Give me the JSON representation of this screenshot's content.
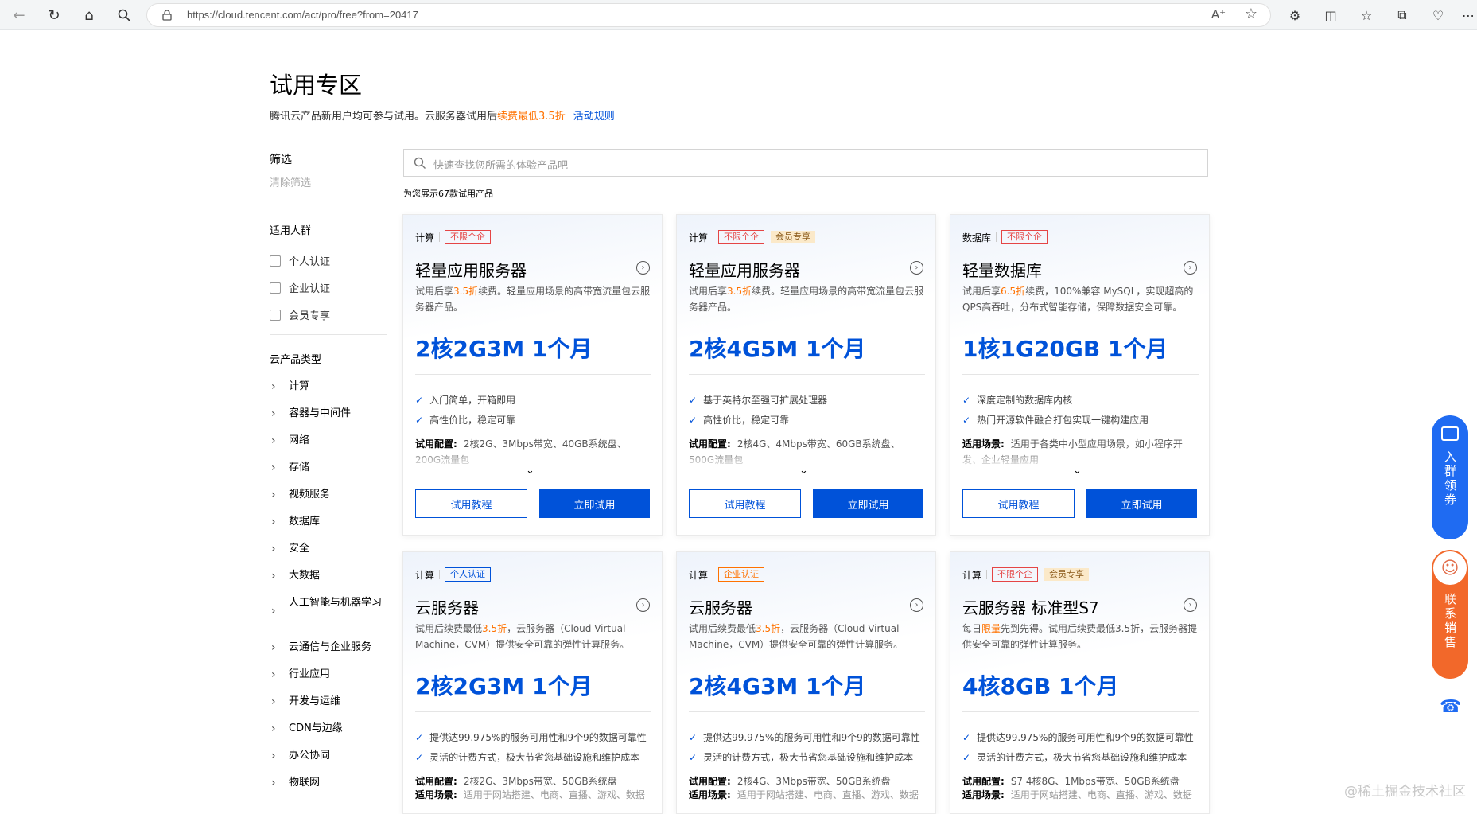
{
  "browser": {
    "url": "https://cloud.tencent.com/act/pro/free?from=20417"
  },
  "header": {
    "title": "试用专区",
    "subtitle_prefix": "腾讯云产品新用户均可参与试用。云服务器试用后",
    "subtitle_highlight": "续费最低3.5折",
    "rules_link": "活动规则"
  },
  "filter": {
    "title": "筛选",
    "clear": "清除筛选",
    "audience_title": "适用人群",
    "audience": [
      "个人认证",
      "企业认证",
      "会员专享"
    ],
    "type_title": "云产品类型",
    "categories": [
      "计算",
      "容器与中间件",
      "网络",
      "存储",
      "视频服务",
      "数据库",
      "安全",
      "大数据",
      "人工智能与机器学习",
      "云通信与企业服务",
      "行业应用",
      "开发与运维",
      "CDN与边缘",
      "办公协同",
      "物联网"
    ]
  },
  "search": {
    "placeholder": "快速查找您所需的体验产品吧",
    "result_count": "为您展示67款试用产品"
  },
  "cards": [
    {
      "category": "计算",
      "tag1": "不限个企",
      "tag2": "",
      "name": "轻量应用服务器",
      "desc_a": "试用后享",
      "desc_o": "3.5折",
      "desc_b": "续费。轻量应用场景的高带宽流量包云服务器产品。",
      "spec": "2核2G3M  1个月",
      "feat1": "入门简单，开箱即用",
      "feat2": "高性价比，稳定可靠",
      "cfg_label": "试用配置:",
      "cfg": "2核2G、3Mbps带宽、40GB系统盘、200G流量包",
      "tutorial": "试用教程",
      "try": "立即试用"
    },
    {
      "category": "计算",
      "tag1": "不限个企",
      "tag2": "会员专享",
      "name": "轻量应用服务器",
      "desc_a": "试用后享",
      "desc_o": "3.5折",
      "desc_b": "续费。轻量应用场景的高带宽流量包云服务器产品。",
      "spec": "2核4G5M  1个月",
      "feat1": "基于英特尔至强可扩展处理器",
      "feat2": "高性价比，稳定可靠",
      "cfg_label": "试用配置:",
      "cfg": "2核4G、4Mbps带宽、60GB系统盘、500G流量包",
      "tutorial": "试用教程",
      "try": "立即试用"
    },
    {
      "category": "数据库",
      "tag1": "不限个企",
      "tag2": "",
      "name": "轻量数据库",
      "desc_a": "试用后享",
      "desc_o": "6.5折",
      "desc_b": "续费，100%兼容 MySQL，实现超高的QPS高吞吐，分布式智能存储，保障数据安全可靠。",
      "spec": "1核1G20GB  1个月",
      "feat1": "深度定制的数据库内核",
      "feat2": "热门开源软件融合打包实现一键构建应用",
      "cfg_label": "适用场景:",
      "cfg": "适用于各类中小型应用场景，如小程序开发、企业轻量应用",
      "tutorial": "试用教程",
      "try": "立即试用"
    },
    {
      "category": "计算",
      "tag1": "个人认证",
      "tag2": "",
      "name": "云服务器",
      "desc_a": "试用后续费最低",
      "desc_o": "3.5折",
      "desc_b": "，云服务器（Cloud Virtual Machine，CVM）提供安全可靠的弹性计算服务。",
      "spec": "2核2G3M  1个月",
      "feat1": "提供达99.975%的服务可用性和9个9的数据可靠性",
      "feat2": "灵活的计费方式，极大节省您基础设施和维护成本",
      "cfg_label": "试用配置:",
      "cfg": "2核2G、3Mbps带宽、50GB系统盘",
      "scene_label": "适用场景:",
      "scene": "适用于网站搭建、电商、直播、游戏、数据"
    },
    {
      "category": "计算",
      "tag1": "企业认证",
      "tag2": "",
      "name": "云服务器",
      "desc_a": "试用后续费最低",
      "desc_o": "3.5折",
      "desc_b": "，云服务器（Cloud Virtual Machine，CVM）提供安全可靠的弹性计算服务。",
      "spec": "2核4G3M  1个月",
      "feat1": "提供达99.975%的服务可用性和9个9的数据可靠性",
      "feat2": "灵活的计费方式，极大节省您基础设施和维护成本",
      "cfg_label": "试用配置:",
      "cfg": "2核4G、3Mbps带宽、50GB系统盘",
      "scene_label": "适用场景:",
      "scene": "适用于网站搭建、电商、直播、游戏、数据"
    },
    {
      "category": "计算",
      "tag1": "不限个企",
      "tag2": "会员专享",
      "name": "云服务器 标准型S7",
      "desc_a": "每日",
      "desc_o": "限量",
      "desc_b": "先到先得。试用后续费最低3.5折，云服务器提供安全可靠的弹性计算服务。",
      "spec": "4核8GB  1个月",
      "feat1": "提供达99.975%的服务可用性和9个9的数据可靠性",
      "feat2": "灵活的计费方式，极大节省您基础设施和维护成本",
      "cfg_label": "试用配置:",
      "cfg": "S7 4核8G、1Mbps带宽、50GB系统盘",
      "scene_label": "适用场景:",
      "scene": "适用于网站搭建、电商、直播、游戏、数据"
    }
  ],
  "floating": {
    "group": "入群领券",
    "sales": "联系销售"
  },
  "watermark": "@稀土掘金技术社区"
}
